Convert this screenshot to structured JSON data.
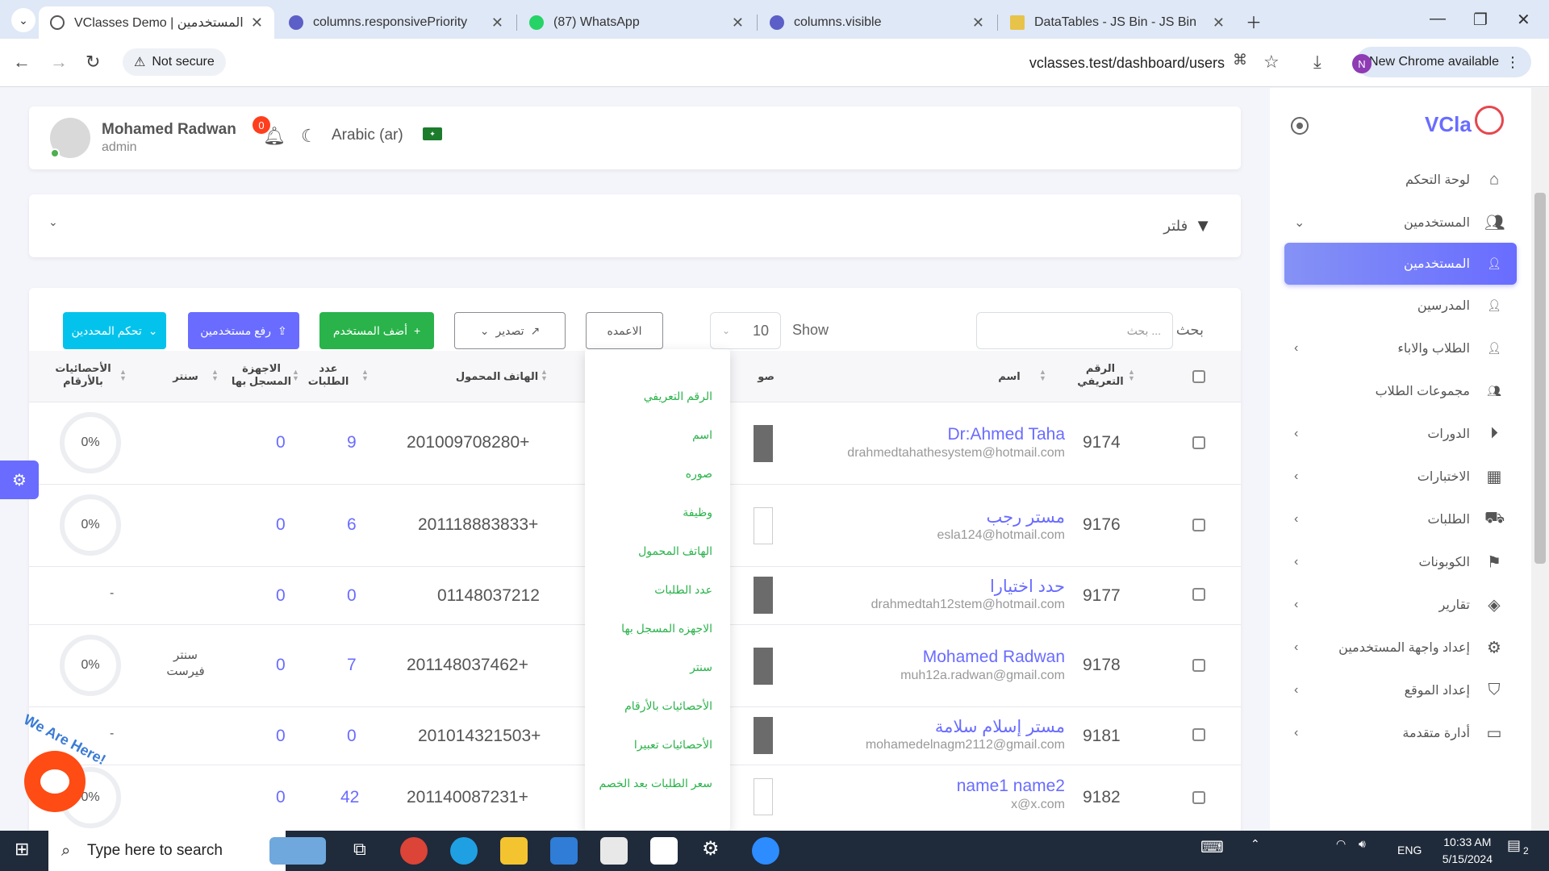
{
  "browser": {
    "tabs": [
      {
        "title": "VClasses Demo | المستخدمين",
        "active": true
      },
      {
        "title": "columns.responsivePriority"
      },
      {
        "title": "(87) WhatsApp"
      },
      {
        "title": "columns.visible"
      },
      {
        "title": "DataTables - JS Bin - JS Bin"
      }
    ],
    "security": "Not secure",
    "url": "vclasses.test/dashboard/users",
    "profile_initial": "N",
    "update_notice": "New Chrome available"
  },
  "header": {
    "user_name": "Mohamed Radwan",
    "user_role": "admin",
    "notification_count": "0",
    "language": "Arabic (ar)"
  },
  "filter": {
    "title": "فلتر"
  },
  "controls": {
    "search_label": "بحث",
    "search_placeholder": "بحث ...",
    "show_label": "Show",
    "page_size": "10",
    "columns_button": "الاعمده",
    "export_button": "تصدير",
    "add_user_button": "أضف المستخدم",
    "upload_users_button": "رفع مستخدمين",
    "selected_control_button": "تحكم المحددين"
  },
  "table": {
    "headers": {
      "id": "الرقم التعريفي",
      "name": "اسم",
      "image": "صو",
      "mobile": "الهاتف المحمول",
      "orders": "عدد الطلبات",
      "devices": "الاجهزة المسجل بها",
      "center": "سنتر",
      "stats": "الأحصائيات بالأرقام"
    },
    "rows": [
      {
        "id": "9174",
        "name": "Dr:Ahmed Taha",
        "email": "drahmedtahathesystem@hotmail.com",
        "mobile": "201009708280+",
        "orders": "9",
        "devices": "0",
        "center": "",
        "stats": "0%"
      },
      {
        "id": "9176",
        "name": "مستر رجب",
        "email": "esla124@hotmail.com",
        "mobile": "201118883833+",
        "orders": "6",
        "devices": "0",
        "center": "",
        "stats": "0%"
      },
      {
        "id": "9177",
        "name": "حدد اختيارا",
        "email": "drahmedtah12stem@hotmail.com",
        "mobile": "01148037212",
        "orders": "0",
        "devices": "0",
        "center": "",
        "stats": "-"
      },
      {
        "id": "9178",
        "name": "Mohamed Radwan",
        "email": "muh12a.radwan@gmail.com",
        "mobile": "201148037462+",
        "orders": "7",
        "devices": "0",
        "center": "سنتر فيرست",
        "stats": "0%"
      },
      {
        "id": "9181",
        "name": "مستر إسلام سلامة",
        "email": "mohamedelnagm2112@gmail.com",
        "mobile": "201014321503+",
        "orders": "0",
        "devices": "0",
        "center": "",
        "stats": "-"
      },
      {
        "id": "9182",
        "name": "name1 name2",
        "email": "x@x.com",
        "mobile": "201140087231+",
        "orders": "42",
        "devices": "0",
        "center": "",
        "stats": "0%"
      }
    ]
  },
  "column_menu": [
    "الرقم التعريفي",
    "اسم",
    "صوره",
    "وظيفة",
    "الهاتف المحمول",
    "عدد الطلبات",
    "الاجهزه المسجل بها",
    "سنتر",
    "الأحصائيات بالأرقام",
    "الأحصائيات تعبيرا",
    "سعر الطلبات بعد الخصم"
  ],
  "sidebar": {
    "brand": "VCla",
    "items": [
      {
        "label": "لوحة التحكم",
        "icon": "home-icon"
      },
      {
        "label": "المستخدمين",
        "icon": "users-icon"
      },
      {
        "label": "المستخدمين",
        "icon": "user-icon"
      },
      {
        "label": "المدرسين",
        "icon": "user-plus-icon"
      },
      {
        "label": "الطلاب والاباء",
        "icon": "user-icon"
      },
      {
        "label": "مجموعات الطلاب",
        "icon": "group-icon"
      },
      {
        "label": "الدورات",
        "icon": "play-icon"
      },
      {
        "label": "الاختبارات",
        "icon": "film-icon"
      },
      {
        "label": "الطلبات",
        "icon": "truck-icon"
      },
      {
        "label": "الكوبونات",
        "icon": "bookmark-icon"
      },
      {
        "label": "تقارير",
        "icon": "layers-icon"
      },
      {
        "label": "إعداد واجهة المستخدمين",
        "icon": "gear-icon"
      },
      {
        "label": "إعداد الموقع",
        "icon": "shield-icon"
      },
      {
        "label": "أدارة متقدمة",
        "icon": "message-icon"
      }
    ]
  },
  "chat_widget": {
    "text": "We Are Here!"
  },
  "taskbar": {
    "search_placeholder": "Type here to search",
    "language": "ENG",
    "time": "10:33 AM",
    "date": "5/15/2024",
    "notifications": "2"
  },
  "colors": {
    "accent": "#696cff",
    "green": "#29b34a",
    "cyan": "#03c3ec"
  }
}
